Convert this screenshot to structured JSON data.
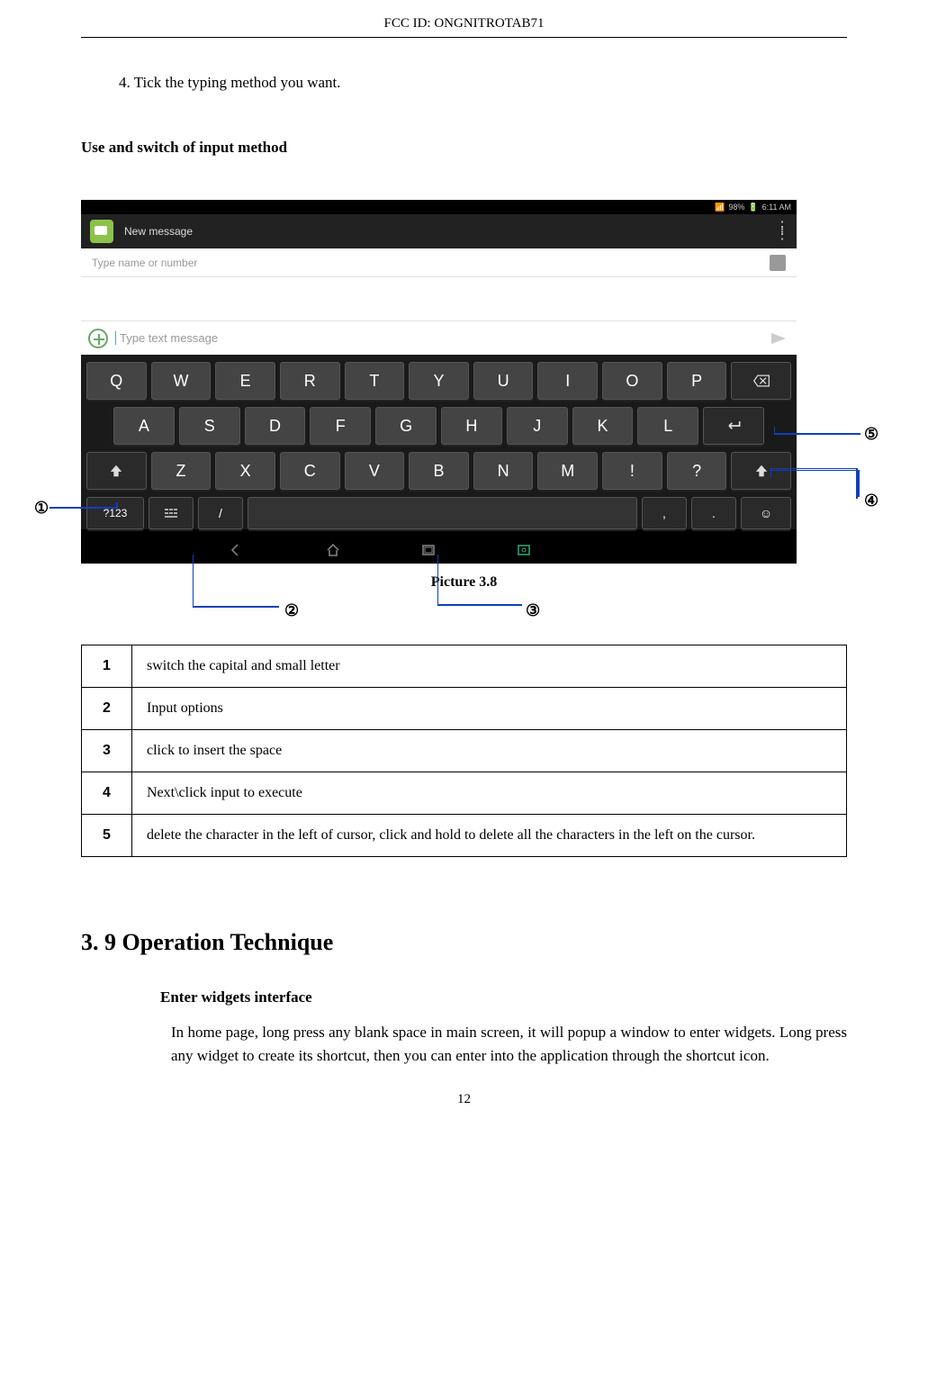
{
  "header": {
    "fcc_id": "FCC ID: ONGNITROTAB71"
  },
  "step": {
    "text": "4. Tick the typing method you want."
  },
  "section_use_switch": "Use and switch of input method",
  "screenshot": {
    "status": {
      "battery": "98%",
      "time": "6:11 AM"
    },
    "app_title": "New message",
    "recipient_placeholder": "Type name or number",
    "compose_placeholder": "Type text message",
    "keyboard": {
      "row1": [
        "Q",
        "W",
        "E",
        "R",
        "T",
        "Y",
        "U",
        "I",
        "O",
        "P"
      ],
      "row2": [
        "A",
        "S",
        "D",
        "F",
        "G",
        "H",
        "J",
        "K",
        "L"
      ],
      "row3": [
        "Z",
        "X",
        "C",
        "V",
        "B",
        "N",
        "M",
        "!",
        "?"
      ],
      "row4_numkey": "?123",
      "row4_slash": "/",
      "row4_comma": ",",
      "row4_period": "."
    }
  },
  "caption": "Picture 3.8",
  "callouts": {
    "c1": "①",
    "c2": "②",
    "c3": "③",
    "c4": "④",
    "c5": "⑤"
  },
  "legend": [
    {
      "num": "1",
      "desc": "switch the capital and small letter"
    },
    {
      "num": "2",
      "desc": "Input options"
    },
    {
      "num": "3",
      "desc": "click to insert the space"
    },
    {
      "num": "4",
      "desc": "Next\\click input to execute"
    },
    {
      "num": "5",
      "desc": "delete the character in the left of cursor, click and hold to delete all the characters in the left on the cursor."
    }
  ],
  "section39": {
    "heading": "3. 9 Operation Technique",
    "sub": "Enter widgets interface",
    "para": "In home page, long press any blank space in main screen, it will popup a window to enter widgets. Long press any widget to create its shortcut, then you can enter into the application through the shortcut icon."
  },
  "page_number": "12"
}
